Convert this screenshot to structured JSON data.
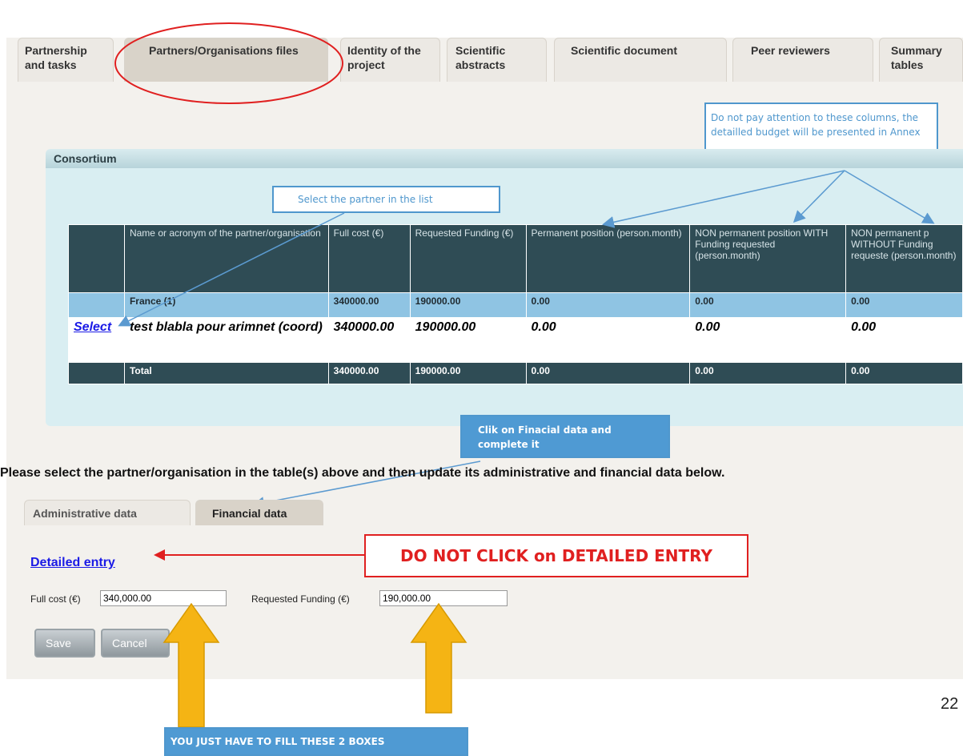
{
  "tabs": [
    {
      "label": "Partnership and tasks"
    },
    {
      "label": "Partners/Organisations files"
    },
    {
      "label": "Identity of the project"
    },
    {
      "label": "Scientific abstracts"
    },
    {
      "label": "Scientific document"
    },
    {
      "label": "Peer reviewers"
    },
    {
      "label": "Summary tables"
    }
  ],
  "consortium": {
    "title": "Consortium",
    "columns": [
      "Name or acronym of the partner/organisation",
      "Full cost (€)",
      "Requested Funding (€)",
      "Permanent position (person.month)",
      "NON permanent position WITH Funding requested (person.month)",
      "NON permanent p WITHOUT Funding requeste (person.month)"
    ],
    "country_row": {
      "name": "France (1)",
      "full_cost": "340000.00",
      "requested": "190000.00",
      "perm": "0.00",
      "nonperm_with": "0.00",
      "nonperm_without": "0.00"
    },
    "data_row": {
      "select": "Select",
      "name": "test blabla pour arimnet (coord)",
      "full_cost": "340000.00",
      "requested": "190000.00",
      "perm": "0.00",
      "nonperm_with": "0.00",
      "nonperm_without": "0.00"
    },
    "total_row": {
      "name": "Total",
      "full_cost": "340000.00",
      "requested": "190000.00",
      "perm": "0.00",
      "nonperm_with": "0.00",
      "nonperm_without": "0.00"
    }
  },
  "callouts": {
    "select_partner": "Select the partner in the list",
    "budget_note": "Do not pay attention to these columns, the detailled budget will be presented in Annex",
    "financial_click": "Clik on Finacial data and complete it",
    "fill_boxes": "YOU JUST HAVE TO FILL THESE 2 BOXES",
    "no_detailed": "DO NOT CLICK on DETAILED ENTRY"
  },
  "instructions": "Please select the partner/organisation in the table(s) above and then update its administrative and financial data below.",
  "subtabs": [
    {
      "label": "Administrative data"
    },
    {
      "label": "Financial data"
    }
  ],
  "financial": {
    "detailed_link": "Detailed entry",
    "full_cost_label": "Full cost (€)",
    "full_cost_value": "340,000.00",
    "requested_label": "Requested Funding (€)",
    "requested_value": "190,000.00",
    "save_label": "Save",
    "cancel_label": "Cancel"
  },
  "page_number": "22",
  "colors": {
    "tab_bg": "#ece9e4",
    "table_header": "#2f4c55",
    "country_row": "#8fc4e3",
    "callout_blue": "#4f97cd",
    "highlight_red": "#e02020",
    "arrow_yellow": "#f5b414"
  }
}
